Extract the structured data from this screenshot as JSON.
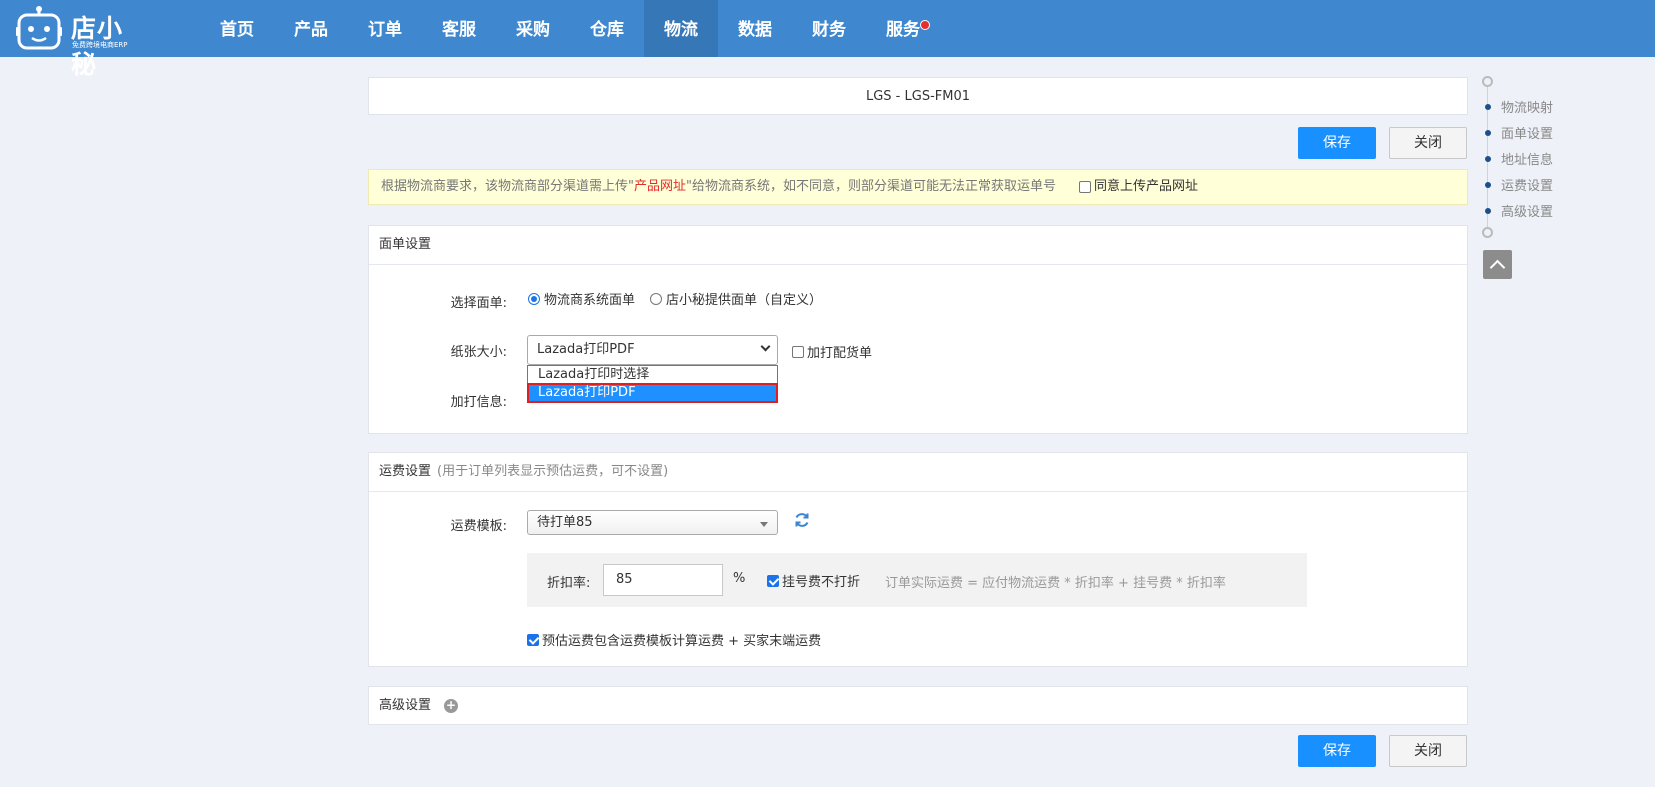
{
  "header": {
    "brand": "店小秘",
    "tagline": "免费跨境电商ERP",
    "nav": [
      {
        "label": "首页"
      },
      {
        "label": "产品"
      },
      {
        "label": "订单"
      },
      {
        "label": "客服"
      },
      {
        "label": "采购"
      },
      {
        "label": "仓库"
      },
      {
        "label": "物流",
        "active": true
      },
      {
        "label": "数据"
      },
      {
        "label": "财务"
      },
      {
        "label": "服务",
        "badge": true
      }
    ]
  },
  "page": {
    "title": "LGS   -   LGS-FM01",
    "save_label": "保存",
    "close_label": "关闭"
  },
  "notice": {
    "text_before": "根据物流商要求，该物流商部分渠道需上传\"",
    "highlight": "产品网址",
    "text_after": "\"给物流商系统，如不同意，则部分渠道可能无法正常获取运单号",
    "agree_label": "同意上传产品网址",
    "agree_checked": false
  },
  "label_settings": {
    "section_title": "面单设置",
    "select_label_text": "选择面单:",
    "option_carrier": "物流商系统面单",
    "option_custom": "店小秘提供面单（自定义）",
    "paper_size_label": "纸张大小:",
    "paper_size_value": "Lazada打印PDF",
    "paper_options": [
      "Lazada打印时选择",
      "Lazada打印PDF"
    ],
    "extra_print_label": "加打配货单",
    "extra_info_label": "加打信息:"
  },
  "freight_settings": {
    "section_title": "运费设置",
    "section_note": "(用于订单列表显示预估运费，可不设置)",
    "template_label": "运费模板:",
    "template_value": "待打单85",
    "discount_label": "折扣率:",
    "discount_value": "85",
    "percent": "%",
    "no_discount_label": "挂号费不打折",
    "no_discount_checked": true,
    "formula": "订单实际运费 = 应付物流运费 * 折扣率 + 挂号费 * 折扣率",
    "include_label": "预估运费包含运费模板计算运费 + 买家末端运费",
    "include_checked": true
  },
  "advanced": {
    "section_title": "高级设置"
  },
  "anchor_nav": [
    {
      "label": "物流映射"
    },
    {
      "label": "面单设置"
    },
    {
      "label": "地址信息"
    },
    {
      "label": "运费设置"
    },
    {
      "label": "高级设置"
    }
  ],
  "colors": {
    "topbar": "#3f88d0",
    "primary": "#1890ff",
    "notice_bg": "#ffffd8",
    "highlight": "#e02d2d"
  }
}
